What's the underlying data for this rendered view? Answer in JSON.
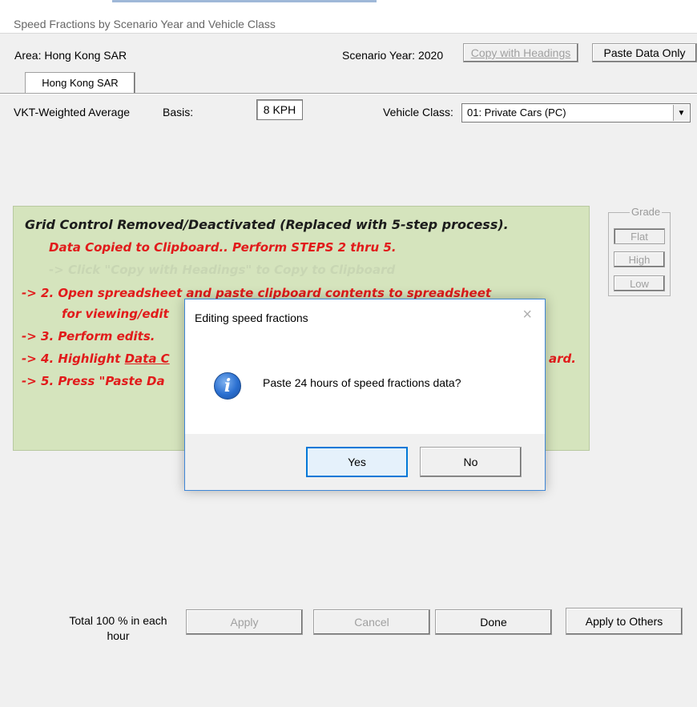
{
  "window": {
    "title": "Speed Fractions by Scenario Year and Vehicle Class"
  },
  "header": {
    "area_label": "Area: Hong Kong SAR",
    "scenario_year_label": "Scenario Year: 2020",
    "copy_button": "Copy with Headings",
    "paste_button": "Paste Data Only"
  },
  "tabs": [
    {
      "label": "Hong Kong SAR"
    }
  ],
  "options": {
    "weighting_label": "VKT-Weighted Average",
    "basis_label": "Basis:",
    "basis_value": "8 KPH",
    "vehicle_class_label": "Vehicle Class:",
    "vehicle_class_value": "01: Private Cars (PC)"
  },
  "panel": {
    "heading": "Grid Control Removed/Deactivated (Replaced with 5-step process).",
    "step1": "Data Copied to Clipboard.. Perform STEPS 2 thru 5.",
    "step2a": "-> 2. Open spreadsheet and paste clipboard contents to spreadsheet",
    "step2b": "for viewing/edit",
    "step3": "-> 3. Perform edits.",
    "step4a": "-> 4. Highlight ",
    "step4_link": "Data C",
    "step4_end": "ard.",
    "step5": "-> 5. Press \"Paste Da"
  },
  "grade": {
    "label": "Grade",
    "buttons": [
      "Flat",
      "High",
      "Low"
    ]
  },
  "dialog": {
    "title": "Editing speed fractions",
    "close": "×",
    "message": "Paste 24 hours of speed fractions data?",
    "icon": "information-icon",
    "yes": "Yes",
    "no": "No"
  },
  "footer": {
    "total_label": "Total 100 % in each hour",
    "apply": "Apply",
    "cancel": "Cancel",
    "done": "Done",
    "apply_to_others": "Apply to Others"
  },
  "colors": {
    "panel_bg": "#d5e4bd",
    "instruction_red": "#e11b1b",
    "dialog_border": "#3f86d6"
  }
}
